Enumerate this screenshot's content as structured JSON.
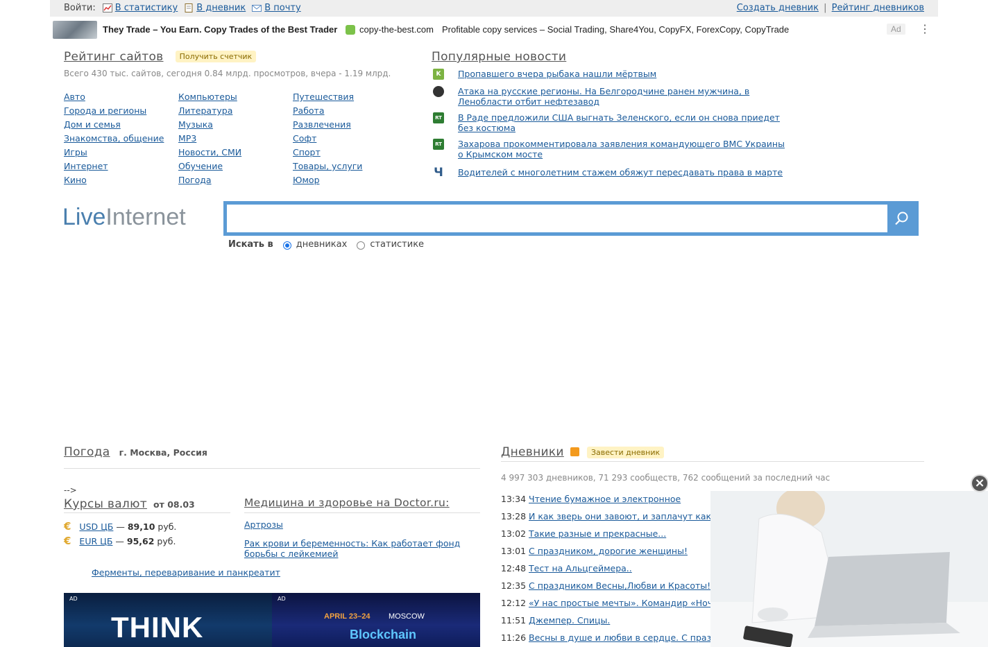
{
  "topbar": {
    "login_label": "Войти:",
    "links": [
      {
        "label": "В статистику",
        "icon": "chart-icon"
      },
      {
        "label": "В дневник",
        "icon": "diary-icon"
      },
      {
        "label": "В почту",
        "icon": "mail-icon"
      }
    ],
    "create_diary": "Создать дневник",
    "separator": "|",
    "diary_rating": "Рейтинг дневников"
  },
  "ad_banner": {
    "title": "They Trade – You Earn. Copy Trades of the Best Trader",
    "domain": "copy-the-best.com",
    "description": "Profitable copy services – Social Trading, Share4You, CopyFX, ForexCopy, CopyTrade",
    "ad_label": "Ad",
    "more": "⋮"
  },
  "rating": {
    "title": "Рейтинг сайтов",
    "counter_badge": "Получить счетчик",
    "stats": "Всего 430 тыс. сайтов, сегодня 0.84 млрд. просмотров, вчера - 1.19 млрд.",
    "columns": [
      [
        "Авто",
        "Города и регионы",
        "Дом и семья",
        "Знакомства, общение",
        "Игры",
        "Интернет",
        "Кино"
      ],
      [
        "Компьютеры",
        "Литература",
        "Музыка",
        "MP3",
        "Новости, СМИ",
        "Обучение",
        "Погода"
      ],
      [
        "Путешествия",
        "Работа",
        "Развлечения",
        "Софт",
        "Спорт",
        "Товары, услуги",
        "Юмор"
      ]
    ]
  },
  "news": {
    "title": "Популярные новости",
    "items": [
      {
        "source_icon": "K",
        "color": "#7cb342",
        "text": "Пропавшего вчера рыбака нашли мёртвым"
      },
      {
        "source_icon": "",
        "color": "#333333",
        "text": "Атака на русские регионы. На Белгородчине ранен мужчина, в Ленобласти отбит нефтезавод"
      },
      {
        "source_icon": "RT",
        "color": "#2e7d32",
        "text": "В Раде предложили США выгнать Зеленского, если он снова приедет без костюма"
      },
      {
        "source_icon": "RT",
        "color": "#2e7d32",
        "text": "Захарова прокомментировала заявления командующего ВМС Украины о Крымском мосте"
      },
      {
        "source_icon": "Ч",
        "color": "#2f5b8a",
        "text": "Водителей с многолетним стажем обяжут пересдавать права в марте"
      }
    ]
  },
  "search": {
    "logo_part1": "Live",
    "logo_part2": "Internet",
    "placeholder": "",
    "search_in_label": "Искать в",
    "option_diaries": "дневниках",
    "option_stats": "статистике"
  },
  "weather": {
    "title": "Погода",
    "location": "г. Москва, Россия",
    "stray": "-->"
  },
  "currency": {
    "title": "Курсы валют",
    "date": "от 08.03",
    "rates": [
      {
        "name": "USD ЦБ",
        "dash": "—",
        "value": "89,10",
        "unit": "руб."
      },
      {
        "name": "EUR ЦБ",
        "dash": "—",
        "value": "95,62",
        "unit": "руб."
      }
    ]
  },
  "medicine": {
    "title": "Медицина и здоровье на Doctor.ru:",
    "links": [
      "Артрозы",
      "Рак крови и беременность: Как работает фонд борьбы с лейкемией"
    ],
    "extra_link": "Ферменты, переваривание и панкреатит"
  },
  "promo": {
    "ad1_tag": "AD",
    "ad1_text": "THINK",
    "ad2_tag": "AD",
    "ad2_date": "APRIL 23–24",
    "ad2_city": "MOSCOW",
    "ad2_text": "Blockchain"
  },
  "diaries": {
    "title": "Дневники",
    "badge": "Завести дневник",
    "stats": "4 997 303 дневников, 71 293 сообществ, 762 сообщений за последний час",
    "posts": [
      {
        "time": "13:34",
        "title": "Чтение бумажное и электронное"
      },
      {
        "time": "13:28",
        "title": "И как зверь они завоют, и заплачут как д"
      },
      {
        "time": "13:02",
        "title": "Такие разные и прекрасные..."
      },
      {
        "time": "13:01",
        "title": "С праздником, дорогие женщины!"
      },
      {
        "time": "12:48",
        "title": "Тест на Альцгеймера.."
      },
      {
        "time": "12:35",
        "title": "С праздником Весны,Любви и Красоты!С"
      },
      {
        "time": "12:12",
        "title": "«У нас простые мечты». Командир «Ночн"
      },
      {
        "time": "11:51",
        "title": "Джемпер. Спицы."
      },
      {
        "time": "11:26",
        "title": "Весны в душе и любви в сердце. С празд"
      }
    ]
  },
  "video_overlay": {
    "close": "×"
  }
}
